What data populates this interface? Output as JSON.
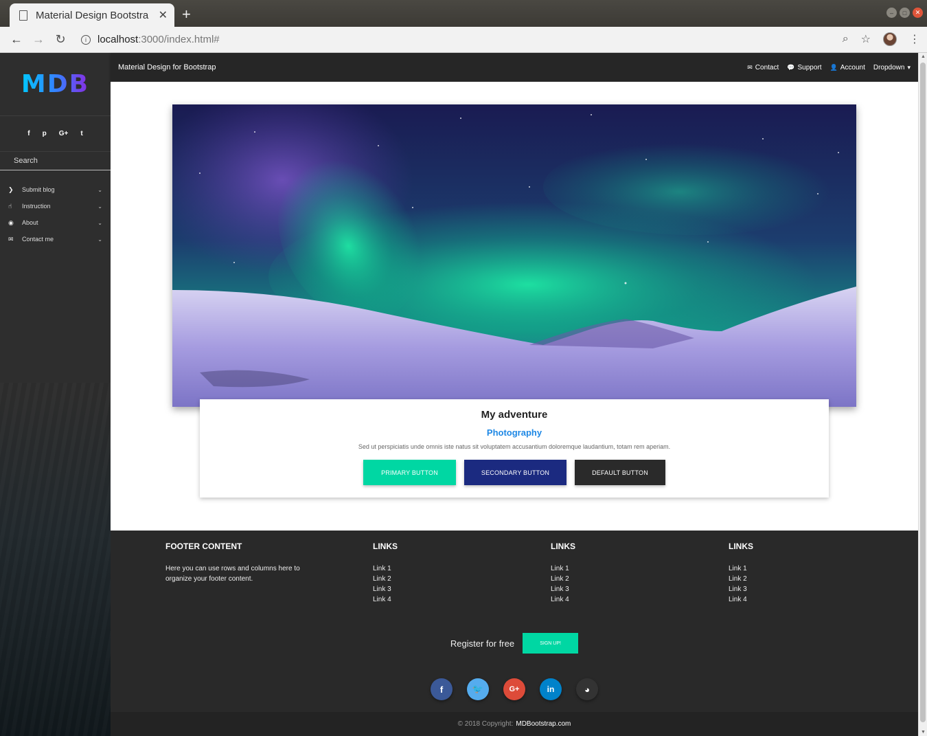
{
  "browser": {
    "tab_title": "Material Design Bootstra",
    "url_host": "localhost",
    "url_path": ":3000/index.html#"
  },
  "sidebar": {
    "logo": "MDB",
    "socials": [
      "f",
      "p",
      "G+",
      "t"
    ],
    "search_placeholder": "Search",
    "items": [
      {
        "label": "Submit blog",
        "icon": "chevron-right-icon"
      },
      {
        "label": "Instruction",
        "icon": "hand-pointer-icon"
      },
      {
        "label": "About",
        "icon": "eye-icon"
      },
      {
        "label": "Contact me",
        "icon": "envelope-icon"
      }
    ]
  },
  "navbar": {
    "brand": "Material Design for Bootstrap",
    "links": [
      "Contact",
      "Support",
      "Account",
      "Dropdown"
    ]
  },
  "card": {
    "title": "My adventure",
    "subtitle": "Photography",
    "text": "Sed ut perspiciatis unde omnis iste natus sit voluptatem accusantium doloremque laudantium, totam rem aperiam.",
    "buttons": [
      "Primary button",
      "Secondary button",
      "Default button"
    ]
  },
  "footer": {
    "col1_title": "Footer Content",
    "col1_text": "Here you can use rows and columns here to organize your footer content.",
    "links_title": "Links",
    "links": [
      "Link 1",
      "Link 2",
      "Link 3",
      "Link 4"
    ],
    "register_text": "Register for free",
    "signup_label": "Sign up!",
    "copyright_prefix": "© 2018 Copyright:",
    "copyright_link": "MDBootstrap.com"
  },
  "colors": {
    "accent": "#00d7a3",
    "secondary": "#1b2a80",
    "link_blue": "#1e88e5"
  }
}
